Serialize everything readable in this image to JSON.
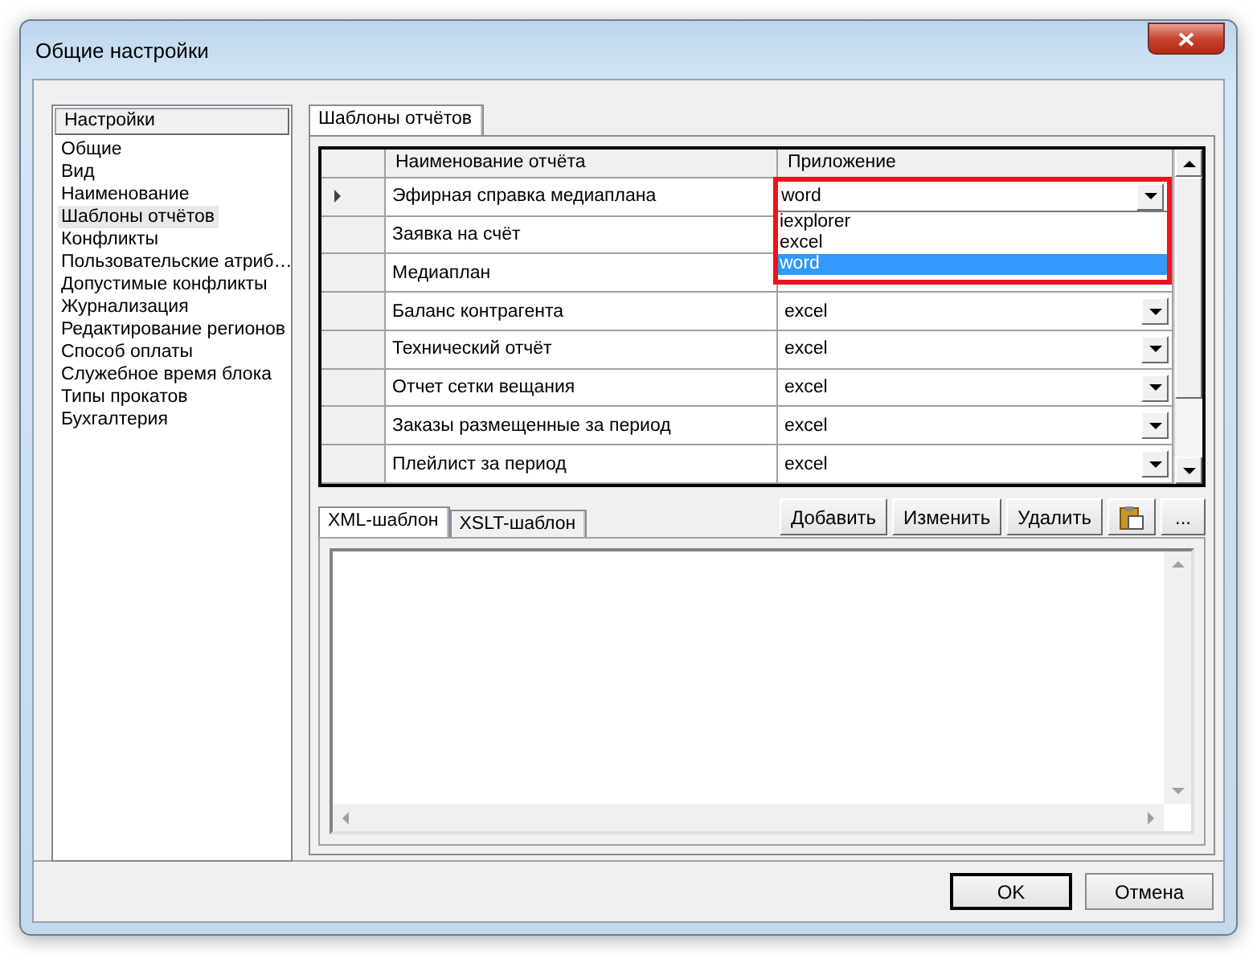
{
  "window": {
    "title": "Общие настройки"
  },
  "sidebar": {
    "header": "Настройки",
    "items": [
      {
        "label": "Общие",
        "selected": false
      },
      {
        "label": "Вид",
        "selected": false
      },
      {
        "label": "Наименование",
        "selected": false
      },
      {
        "label": "Шаблоны отчётов",
        "selected": true
      },
      {
        "label": "Конфликты",
        "selected": false
      },
      {
        "label": "Пользовательские атриб…",
        "selected": false
      },
      {
        "label": "Допустимые конфликты",
        "selected": false
      },
      {
        "label": "Журнализация",
        "selected": false
      },
      {
        "label": "Редактирование регионов",
        "selected": false
      },
      {
        "label": "Способ оплаты",
        "selected": false
      },
      {
        "label": "Служебное время блока",
        "selected": false
      },
      {
        "label": "Типы прокатов",
        "selected": false
      },
      {
        "label": "Бухгалтерия",
        "selected": false
      }
    ]
  },
  "tabs": [
    {
      "label": "Шаблоны отчётов",
      "selected": true
    }
  ],
  "table": {
    "columns": [
      "Наименование отчёта",
      "Приложение"
    ],
    "rows": [
      {
        "name": "Эфирная справка медиаплана",
        "selected": true
      },
      {
        "name": "Заявка на счёт",
        "selected": false
      },
      {
        "name": "Медиаплан",
        "selected": false
      },
      {
        "name": "Баланс контрагента",
        "app": "excel",
        "selected": false
      },
      {
        "name": "Технический отчёт",
        "app": "excel",
        "selected": false
      },
      {
        "name": "Отчет сетки вещания",
        "app": "excel",
        "selected": false
      },
      {
        "name": "Заказы размещенные за период",
        "app": "excel",
        "selected": false
      },
      {
        "name": "Плейлист за период",
        "app": "excel",
        "selected": false
      }
    ],
    "dropdown": {
      "value": "word",
      "options": [
        {
          "label": "iexplorer",
          "selected": false
        },
        {
          "label": "excel",
          "selected": false
        },
        {
          "label": "word",
          "selected": true
        }
      ]
    }
  },
  "template_tabs": [
    {
      "label": "XML-шаблон",
      "selected": true
    },
    {
      "label": "XSLT-шаблон",
      "selected": false
    }
  ],
  "template_buttons": [
    {
      "kind": "text",
      "label": "Добавить"
    },
    {
      "kind": "text",
      "label": "Изменить"
    },
    {
      "kind": "text",
      "label": "Удалить"
    },
    {
      "kind": "icon"
    },
    {
      "kind": "text",
      "label": "..."
    }
  ],
  "buttons": [
    {
      "label": "OK",
      "default": true
    },
    {
      "label": "Отмена",
      "default": false
    }
  ]
}
